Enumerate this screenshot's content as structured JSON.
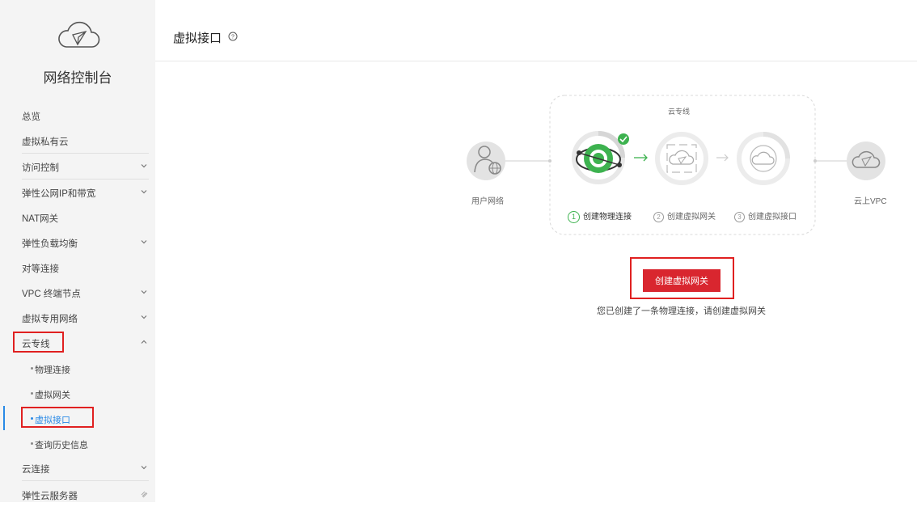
{
  "sidebar": {
    "title": "网络控制台",
    "items": [
      {
        "label": "总览"
      },
      {
        "label": "虚拟私有云"
      },
      {
        "label": "访问控制"
      },
      {
        "label": "弹性公网IP和带宽"
      },
      {
        "label": "NAT网关"
      },
      {
        "label": "弹性负载均衡"
      },
      {
        "label": "对等连接"
      },
      {
        "label": "VPC 终端节点"
      },
      {
        "label": "虚拟专用网络"
      },
      {
        "label": "云专线"
      },
      {
        "label": "云连接"
      },
      {
        "label": "弹性云服务器"
      }
    ],
    "subitems": [
      {
        "label": "物理连接"
      },
      {
        "label": "虚拟网关"
      },
      {
        "label": "虚拟接口"
      },
      {
        "label": "查询历史信息"
      }
    ],
    "active_color": "#2a8ae6"
  },
  "header": {
    "title": "虚拟接口"
  },
  "diagram": {
    "group_label": "云专线",
    "user_network": "用户网络",
    "cloud_vpc": "云上VPC",
    "steps": [
      {
        "num": "1",
        "label": "创建物理连接"
      },
      {
        "num": "2",
        "label": "创建虚拟网关"
      },
      {
        "num": "3",
        "label": "创建虚拟接口"
      }
    ]
  },
  "action": {
    "button_label": "创建虚拟网关",
    "hint": "您已创建了一条物理连接，请创建虚拟网关"
  },
  "colors": {
    "accent_red": "#d9262f",
    "highlight_red": "#e02020",
    "step_done": "#3db24f"
  }
}
